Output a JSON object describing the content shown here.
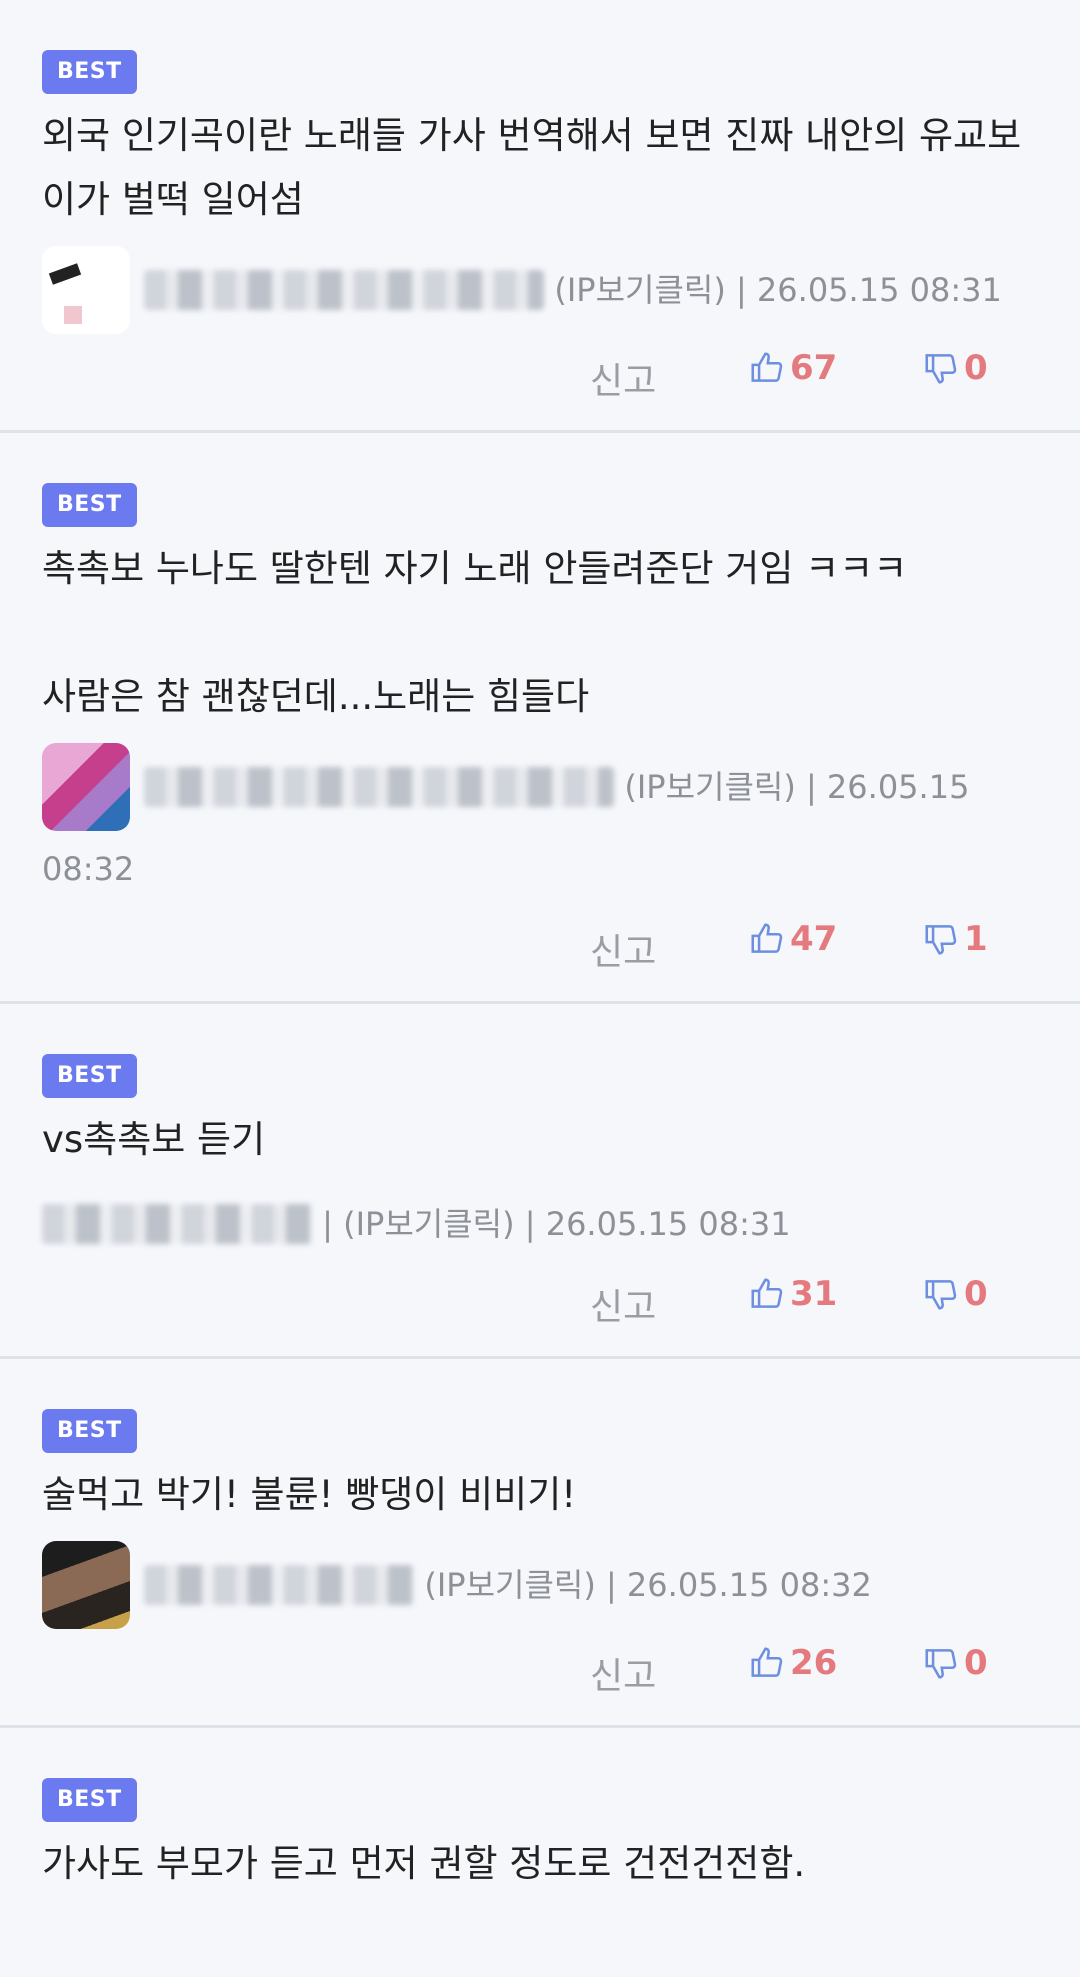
{
  "badge": "BEST",
  "actions": {
    "report_label": "신고"
  },
  "comments": [
    {
      "text": "외국 인기곡이란 노래들 가사 번역해서 보면 진짜 내안의 유교보이가 벌떡 일어섬",
      "meta": "(IP보기클릭) | 26.05.15 08:31",
      "likes": "67",
      "dislikes": "0"
    },
    {
      "text": "촉촉보 누나도 딸한텐 자기 노래 안들려준단 거임 ㅋㅋㅋ\n\n사람은 참 괜찮던데...노래는 힘들다",
      "meta": "(IP보기클릭) | 26.05.15 08:32",
      "likes": "47",
      "dislikes": "1"
    },
    {
      "text": "vs촉촉보 듣기",
      "meta": "| (IP보기클릭) | 26.05.15 08:31",
      "likes": "31",
      "dislikes": "0"
    },
    {
      "text": "술먹고 박기! 불륜! 빵댕이 비비기!",
      "meta": "(IP보기클릭) | 26.05.15 08:32",
      "likes": "26",
      "dislikes": "0"
    },
    {
      "text": "가사도 부모가 듣고 먼저 권할 정도로 건전건전함."
    }
  ]
}
